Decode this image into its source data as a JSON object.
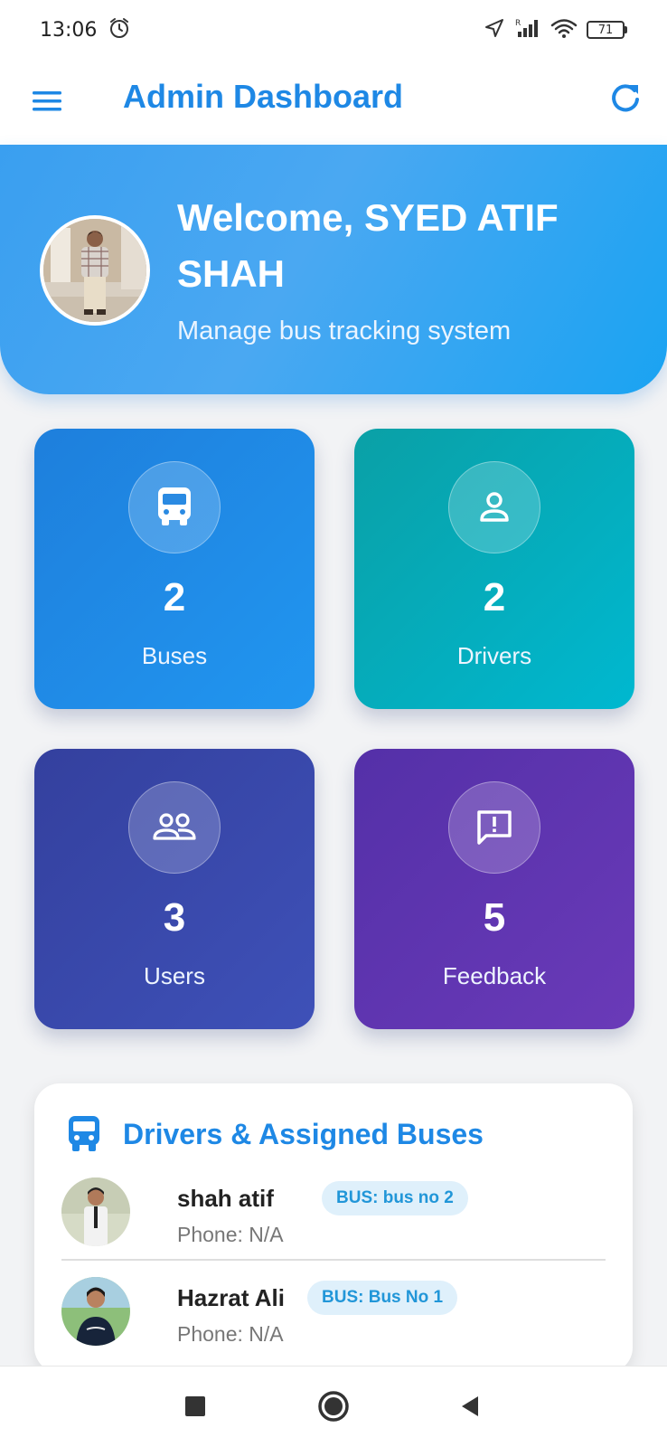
{
  "status_bar": {
    "time": "13:06",
    "battery": "71",
    "icons": [
      "alarm-icon",
      "location-arrow-icon",
      "signal-icon",
      "wifi-icon",
      "battery-icon"
    ]
  },
  "app_bar": {
    "title": "Admin Dashboard",
    "menu_icon": "menu-icon",
    "refresh_icon": "refresh-icon"
  },
  "hero": {
    "welcome": "Welcome, SYED ATIF SHAH",
    "subtitle": "Manage bus tracking system"
  },
  "stats": {
    "buses": {
      "count": "2",
      "label": "Buses",
      "icon": "bus-icon",
      "color": "#1e7fdc"
    },
    "drivers": {
      "count": "2",
      "label": "Drivers",
      "icon": "person-icon",
      "color": "#00b1c4"
    },
    "users": {
      "count": "3",
      "label": "Users",
      "icon": "people-icon",
      "color": "#3a48ab"
    },
    "feedback": {
      "count": "5",
      "label": "Feedback",
      "icon": "feedback-icon",
      "color": "#5e34b0"
    }
  },
  "drivers_panel": {
    "title": "Drivers & Assigned Buses",
    "rows": [
      {
        "name": "shah atif",
        "bus": "BUS: bus no 2",
        "phone": "Phone: N/A"
      },
      {
        "name": "Hazrat Ali",
        "bus": "BUS: Bus No 1",
        "phone": "Phone: N/A"
      }
    ]
  },
  "colors": {
    "accent": "#1e88e5",
    "hero": "#3a9ff0",
    "badge_bg": "#dff0fb"
  }
}
